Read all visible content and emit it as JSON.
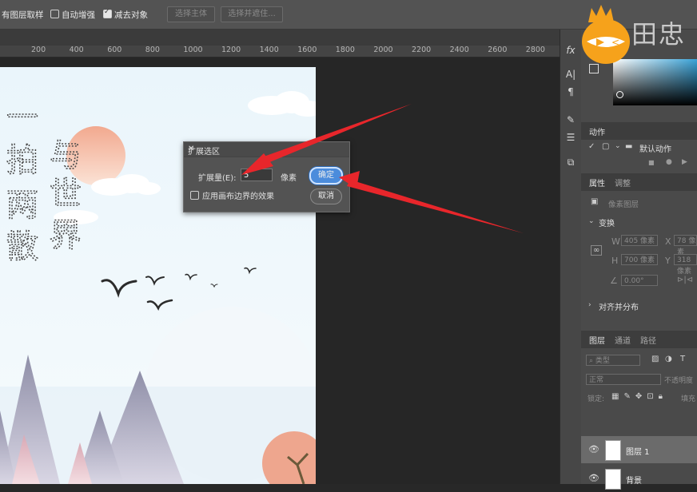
{
  "options_bar": {
    "sample_all_layers": "有图层取样",
    "auto_enhance": "自动增强",
    "subtract_subject": "减去对象",
    "select_subject": "选择主体",
    "select_and_mask": "选择并遮住..."
  },
  "ruler": {
    "ticks": [
      "200",
      "400",
      "600",
      "800",
      "1000",
      "1200",
      "1400",
      "1600",
      "1800",
      "2000",
      "2200",
      "2400",
      "2600",
      "2800"
    ]
  },
  "artwork": {
    "poem_left": [
      "一",
      "拍",
      "两",
      "散"
    ],
    "poem_right": [
      "与",
      "世",
      "界"
    ]
  },
  "dialog": {
    "title": "扩展选区",
    "close": "✕",
    "expand_label": "扩展量(E):",
    "expand_value": "5",
    "unit": "像素",
    "ok": "确定",
    "cancel": "取消",
    "apply_canvas_bounds": "应用画布边界的效果"
  },
  "watermark": {
    "text": "田忠"
  },
  "panels": {
    "actions": {
      "tab": "动作",
      "default_actions": "默认动作"
    },
    "properties": {
      "tab_properties": "属性",
      "tab_adjust": "调整",
      "pixel_layer": "像素图层",
      "transform": "变换",
      "w_label": "W",
      "w_value": "405 像素",
      "x_label": "X",
      "x_value": "78 像素",
      "h_label": "H",
      "h_value": "700 像素",
      "y_label": "Y",
      "y_value": "318 像素",
      "angle_value": "0.00°",
      "align": "对齐并分布"
    },
    "layers": {
      "tab_layers": "图层",
      "tab_channels": "通道",
      "tab_paths": "路径",
      "filter_kind": "类型",
      "blend_mode": "正常",
      "opacity": "不透明度",
      "lock_label": "锁定:",
      "fill_label": "填充",
      "items": [
        {
          "name": "图层 1"
        },
        {
          "name": "背景"
        }
      ]
    }
  }
}
